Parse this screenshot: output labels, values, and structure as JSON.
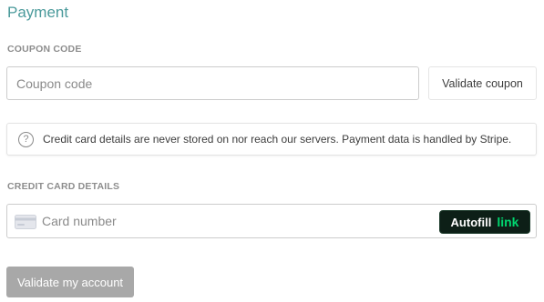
{
  "payment": {
    "title": "Payment",
    "coupon": {
      "label": "COUPON CODE",
      "placeholder": "Coupon code",
      "value": "",
      "validate_button": "Validate coupon"
    },
    "notice": {
      "icon": "question-circle-icon",
      "text": "Credit card details are never stored on nor reach our servers. Payment data is handled by Stripe."
    },
    "card": {
      "label": "CREDIT CARD DETAILS",
      "icon": "credit-card-icon",
      "placeholder": "Card number",
      "value": "",
      "autofill_label": "Autofill",
      "autofill_brand": "link",
      "autofill_brand_color": "#00d66f"
    },
    "submit_button": "Validate my account"
  },
  "colors": {
    "title": "#4a9a9b",
    "section_label": "#8d8d8d",
    "submit_disabled": "#a8a8a8",
    "autofill_bg": "#0d1f17"
  }
}
